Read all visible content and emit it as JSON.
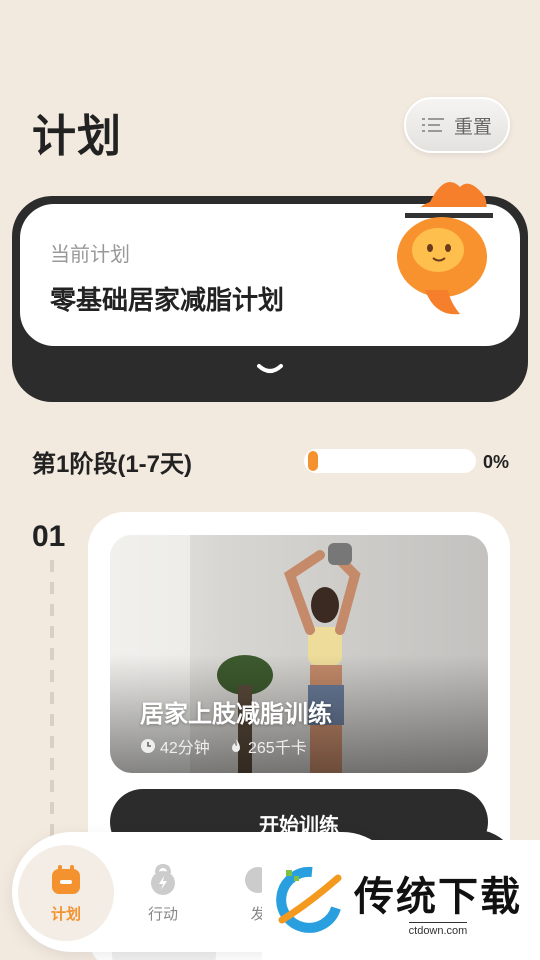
{
  "header": {
    "title": "计划",
    "reset_label": "重置"
  },
  "current_plan": {
    "label": "当前计划",
    "name": "零基础居家减脂计划"
  },
  "stage": {
    "title": "第1阶段(1-7天)",
    "progress_fraction": 0.0,
    "progress_label": "0%"
  },
  "days": [
    {
      "number": "01",
      "workout": {
        "title": "居家上肢减脂训练",
        "duration": "42分钟",
        "calories": "265千卡",
        "start_label": "开始训练"
      }
    }
  ],
  "tabbar": {
    "tabs": [
      {
        "label": "计划",
        "icon": "calendar-icon",
        "active": true
      },
      {
        "label": "行动",
        "icon": "kettlebell-icon",
        "active": false
      },
      {
        "label": "发",
        "icon": "discover-icon",
        "active": false
      }
    ]
  },
  "watermark": {
    "title": "传统下载",
    "url": "ctdown.com"
  },
  "colors": {
    "accent": "#f3922e",
    "dark": "#2c2c2c",
    "background": "#f2e9df"
  }
}
